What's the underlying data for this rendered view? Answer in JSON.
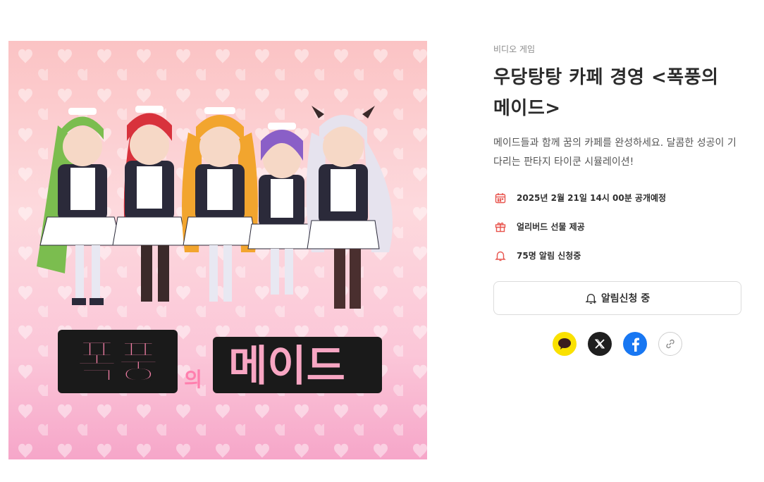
{
  "product": {
    "category": "비디오 게임",
    "title": "우당탕탕 카페 경영 <폭풍의 메이드>",
    "description": "메이드들과 함께 꿈의 카페를 완성하세요. 달콤한 성공이 기다리는 판타지 타이쿤 시뮬레이션!",
    "cover_title_part1": "폭풍",
    "cover_title_part2": "의",
    "cover_title_part3": "메이드"
  },
  "meta": [
    {
      "icon": "calendar-icon",
      "text": "2025년 2월 21일 14시 00분 공개예정"
    },
    {
      "icon": "gift-icon",
      "text": "얼리버드 선물 제공"
    },
    {
      "icon": "bell-icon",
      "text": "75명 알림 신청중"
    }
  ],
  "notify_button": {
    "label": "알림신청 중",
    "icon": "bell-ring-icon"
  },
  "share": [
    {
      "name": "kakaotalk-share",
      "icon": "kakao-icon"
    },
    {
      "name": "x-share",
      "icon": "x-icon"
    },
    {
      "name": "facebook-share",
      "icon": "facebook-icon"
    },
    {
      "name": "copy-link",
      "icon": "link-icon"
    }
  ],
  "colors": {
    "accent": "#e8554e",
    "kakao": "#fae100",
    "x": "#1f1f1f",
    "facebook": "#1877f2"
  }
}
